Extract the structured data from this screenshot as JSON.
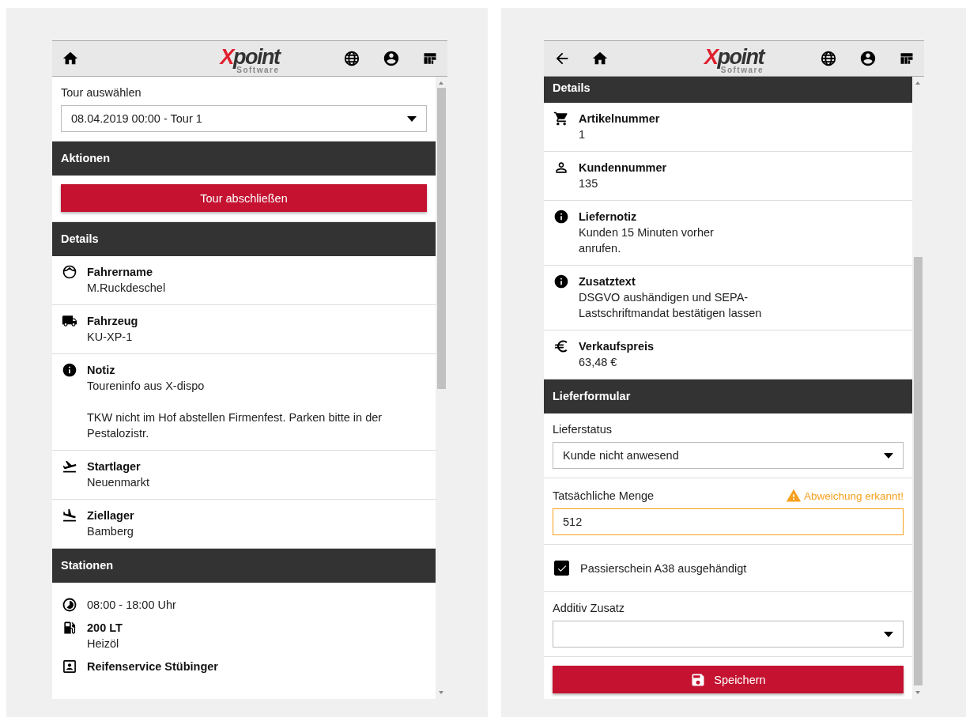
{
  "screens": [
    {
      "header": {
        "back_button": false,
        "logo": "Xpoint",
        "logo_sub": "Software"
      },
      "blocks": [
        {
          "kind": "select",
          "label": "Tour auswählen",
          "value": "08.04.2019 00:00 - Tour 1"
        },
        {
          "kind": "heading",
          "text": "Aktionen"
        },
        {
          "kind": "button",
          "label": "Tour abschließen"
        },
        {
          "kind": "heading",
          "text": "Details"
        },
        {
          "kind": "driver",
          "title": "Fahrername",
          "text": "M.Ruckdeschel"
        },
        {
          "kind": "vehicle",
          "title": "Fahrzeug",
          "text": "KU-XP-1"
        },
        {
          "kind": "note",
          "title": "Notiz",
          "text": "Toureninfo aus X-dispo",
          "note": "TKW nicht im Hof abstellen Firmenfest. Parken bitte in der Pestalozistr."
        },
        {
          "kind": "origin",
          "title": "Startlager",
          "text": "Neuenmarkt"
        },
        {
          "kind": "destination",
          "title": "Ziellager",
          "text": "Bamberg"
        },
        {
          "kind": "heading",
          "text": "Stationen"
        },
        {
          "kind": "stations",
          "items": [
            {
              "kind": "time",
              "text": "08:00 - 18:00 Uhr"
            },
            {
              "kind": "product",
              "title": "200 LT",
              "text": "Heizöl"
            },
            {
              "kind": "customer",
              "title": "Reifenservice Stübinger"
            }
          ]
        }
      ]
    },
    {
      "header": {
        "back_button": true,
        "logo": "Xpoint",
        "logo_sub": "Software"
      },
      "blocks": [
        {
          "kind": "heading",
          "text": "Details"
        },
        {
          "kind": "article",
          "title": "Artikelnummer",
          "text": "1"
        },
        {
          "kind": "customer",
          "title": "Kundennummer",
          "text": "135"
        },
        {
          "kind": "note",
          "title": "Liefernotiz",
          "text": "Kunden 15 Minuten vorher\nanrufen."
        },
        {
          "kind": "note",
          "title": "Zusatztext",
          "text": "DSGVO aushändigen und SEPA-\nLastschriftmandat bestätigen lassen"
        },
        {
          "kind": "price",
          "title": "Verkaufspreis",
          "text": "63,48 €"
        },
        {
          "kind": "heading",
          "text": "Lieferformular"
        },
        {
          "kind": "select",
          "label": "Lieferstatus",
          "value": "Kunde nicht anwesend"
        },
        {
          "kind": "input",
          "label": "Tatsächliche Menge",
          "value": "512",
          "warning": "Abweichung erkannt!"
        },
        {
          "kind": "checkbox",
          "label": "Passierschein A38 ausgehändigt",
          "checked": true
        },
        {
          "kind": "select",
          "label": "Additiv Zusatz"
        },
        {
          "kind": "save",
          "label": "Speichern"
        }
      ]
    }
  ]
}
